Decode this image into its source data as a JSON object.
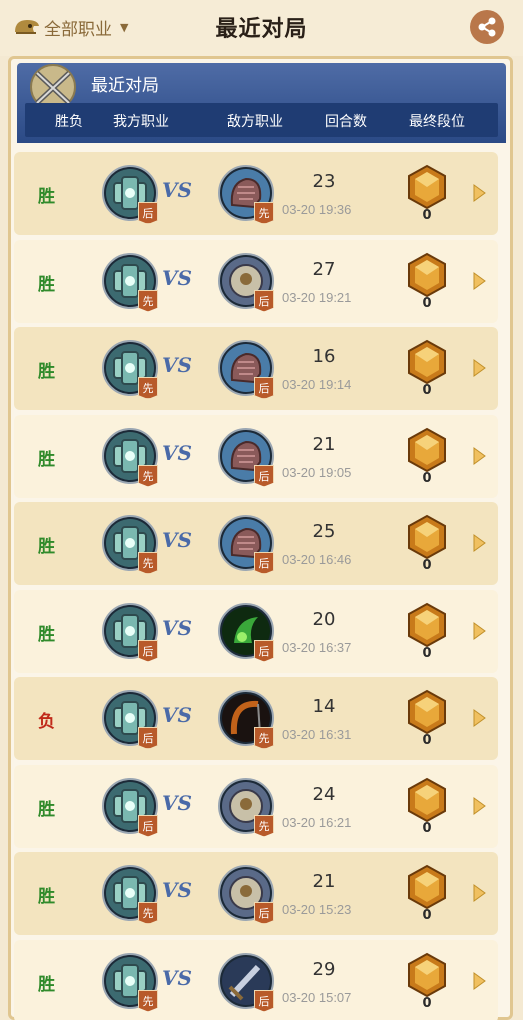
{
  "header": {
    "filter_label": "全部职业",
    "title": "最近对局",
    "filter_icon": "helmet-icon",
    "dropdown_icon": "chevron-down-icon",
    "share_icon": "share-icon"
  },
  "panel": {
    "title": "最近对局",
    "columns": [
      "胜负",
      "我方职业",
      "敌方职业",
      "回合数",
      "最终段位"
    ]
  },
  "colors": {
    "win": "#2f8a2a",
    "lose": "#c02a1a",
    "header_blue": "#2b4a86",
    "row_alt": "#f3e4bf"
  },
  "matches": [
    {
      "result": "胜",
      "my_turn": "后",
      "enemy_class": "druid",
      "enemy_turn": "先",
      "rounds": "23",
      "time": "03-20 19:36",
      "rank": "0"
    },
    {
      "result": "胜",
      "my_turn": "先",
      "enemy_class": "paladin",
      "enemy_turn": "后",
      "rounds": "27",
      "time": "03-20 19:21",
      "rank": "0"
    },
    {
      "result": "胜",
      "my_turn": "先",
      "enemy_class": "druid",
      "enemy_turn": "后",
      "rounds": "16",
      "time": "03-20 19:14",
      "rank": "0"
    },
    {
      "result": "胜",
      "my_turn": "先",
      "enemy_class": "druid",
      "enemy_turn": "后",
      "rounds": "21",
      "time": "03-20 19:05",
      "rank": "0"
    },
    {
      "result": "胜",
      "my_turn": "先",
      "enemy_class": "druid",
      "enemy_turn": "后",
      "rounds": "25",
      "time": "03-20 16:46",
      "rank": "0"
    },
    {
      "result": "胜",
      "my_turn": "后",
      "enemy_class": "shaman",
      "enemy_turn": "后",
      "rounds": "20",
      "time": "03-20 16:37",
      "rank": "0"
    },
    {
      "result": "负",
      "my_turn": "后",
      "enemy_class": "hunter",
      "enemy_turn": "先",
      "rounds": "14",
      "time": "03-20 16:31",
      "rank": "0"
    },
    {
      "result": "胜",
      "my_turn": "后",
      "enemy_class": "paladin",
      "enemy_turn": "先",
      "rounds": "24",
      "time": "03-20 16:21",
      "rank": "0"
    },
    {
      "result": "胜",
      "my_turn": "先",
      "enemy_class": "paladin",
      "enemy_turn": "后",
      "rounds": "21",
      "time": "03-20 15:23",
      "rank": "0"
    },
    {
      "result": "胜",
      "my_turn": "先",
      "enemy_class": "warrior",
      "enemy_turn": "后",
      "rounds": "29",
      "time": "03-20 15:07",
      "rank": "0"
    }
  ],
  "icons": {
    "vs": "VS",
    "my_class": "mage-portrait-icon",
    "rank_gem": "rank-gem-icon",
    "row_arrow": "play-arrow-icon"
  }
}
